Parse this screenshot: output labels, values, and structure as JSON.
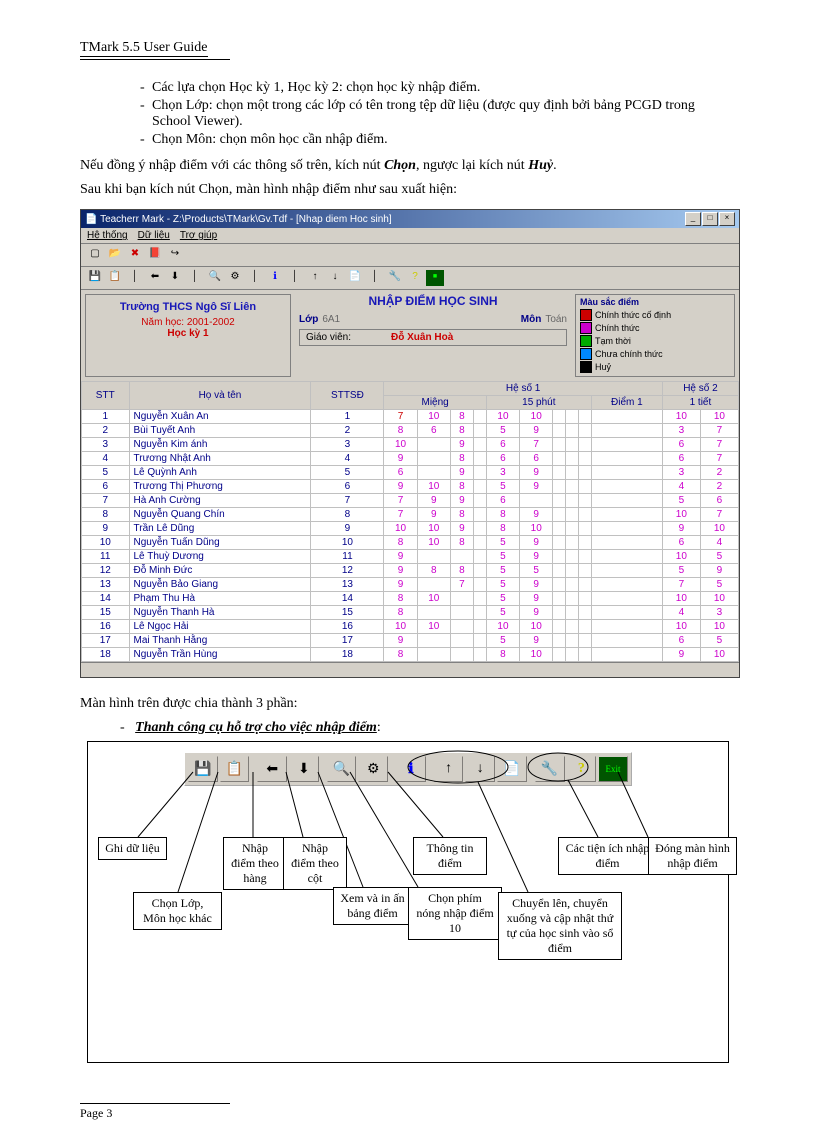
{
  "header": "TMark 5.5 User Guide",
  "bullets": [
    "Các lựa chọn Học kỳ 1, Học kỳ 2: chọn học kỳ nhập điểm.",
    "Chọn Lớp: chọn một trong các lớp có tên trong tệp dữ liệu (được quy định bởi bảng PCGD trong School Viewer).",
    "Chọn Môn: chọn môn học cần nhập điểm."
  ],
  "p1a": "Nếu đồng ý nhập điểm với các thông số trên, kích nút ",
  "p1b": "Chọn",
  "p1c": ", ngược lại kích nút ",
  "p1d": "Huỷ",
  "p1e": ".",
  "p2": "Sau khi bạn kích nút Chọn, màn hình nhập điểm như sau xuất hiện:",
  "win": {
    "title": "Teacherr Mark - Z:\\Products\\TMark\\Gv.Tdf - [Nhap diem Hoc sinh]",
    "menu": [
      "Hệ thống",
      "Dữ liệu",
      "Trợ giúp"
    ],
    "school": "Trường THCS Ngô Sĩ Liên",
    "year": "Năm học: 2001-2002",
    "sem": "Học kỳ 1",
    "mainTitle": "NHẬP ĐIỂM HỌC SINH",
    "lop": "Lớp",
    "lopv": "6A1",
    "mon": "Môn",
    "monv": "Toán",
    "gv": "Giáo viên:",
    "gvv": "Đỗ Xuân Hoà",
    "legend": {
      "h": "Màu sắc điểm",
      "items": [
        {
          "c": "#c00",
          "t": "Chính thức cố định"
        },
        {
          "c": "#c0c",
          "t": "Chính thức"
        },
        {
          "c": "#0a0",
          "t": "Tạm thời"
        },
        {
          "c": "#08f",
          "t": "Chưa chính thức"
        },
        {
          "c": "#000",
          "t": "Huỷ"
        }
      ]
    },
    "cols": {
      "stt": "STT",
      "name": "Họ và tên",
      "sttsd": "STTSĐ",
      "hs1": "Hệ số 1",
      "hs2": "Hệ số 2",
      "mieng": "Miệng",
      "p15": "15 phút",
      "d1": "Điểm 1",
      "t1": "1 tiết"
    },
    "rows": [
      {
        "i": 1,
        "n": "Nguyễn Xuân An",
        "s": 1,
        "m": [
          "7",
          "10",
          "8"
        ],
        "p": [
          "10",
          "10"
        ],
        "d": [],
        "t": [
          "10",
          "10"
        ]
      },
      {
        "i": 2,
        "n": "Bùi Tuyết Anh",
        "s": 2,
        "m": [
          "8",
          "6",
          "8"
        ],
        "p": [
          "5",
          "9"
        ],
        "d": [],
        "t": [
          "3",
          "7"
        ]
      },
      {
        "i": 3,
        "n": "Nguyễn Kim ánh",
        "s": 3,
        "m": [
          "10",
          "",
          "9"
        ],
        "p": [
          "6",
          "7"
        ],
        "d": [],
        "t": [
          "6",
          "7"
        ]
      },
      {
        "i": 4,
        "n": "Trương Nhật Anh",
        "s": 4,
        "m": [
          "9",
          "",
          "8"
        ],
        "p": [
          "6",
          "6"
        ],
        "d": [],
        "t": [
          "6",
          "7"
        ]
      },
      {
        "i": 5,
        "n": "Lê Quỳnh Anh",
        "s": 5,
        "m": [
          "6",
          "",
          "9"
        ],
        "p": [
          "3",
          "9"
        ],
        "d": [],
        "t": [
          "3",
          "2"
        ]
      },
      {
        "i": 6,
        "n": "Trương Thị Phương",
        "s": 6,
        "m": [
          "9",
          "10",
          "8"
        ],
        "p": [
          "5",
          "9"
        ],
        "d": [],
        "t": [
          "4",
          "2"
        ]
      },
      {
        "i": 7,
        "n": "Hà Anh Cường",
        "s": 7,
        "m": [
          "7",
          "9",
          "9"
        ],
        "p": [
          "6",
          ""
        ],
        "d": [],
        "t": [
          "5",
          "6"
        ]
      },
      {
        "i": 8,
        "n": "Nguyễn Quang Chín",
        "s": 8,
        "m": [
          "7",
          "9",
          "8"
        ],
        "p": [
          "8",
          "9"
        ],
        "d": [],
        "t": [
          "10",
          "7"
        ]
      },
      {
        "i": 9,
        "n": "Trần Lê Dũng",
        "s": 9,
        "m": [
          "10",
          "10",
          "9"
        ],
        "p": [
          "8",
          "10"
        ],
        "d": [],
        "t": [
          "9",
          "10"
        ]
      },
      {
        "i": 10,
        "n": "Nguyễn Tuấn Dũng",
        "s": 10,
        "m": [
          "8",
          "10",
          "8"
        ],
        "p": [
          "5",
          "9"
        ],
        "d": [],
        "t": [
          "6",
          "4"
        ]
      },
      {
        "i": 11,
        "n": "Lê Thuỳ Dương",
        "s": 11,
        "m": [
          "9",
          "",
          ""
        ],
        "p": [
          "5",
          "9"
        ],
        "d": [],
        "t": [
          "10",
          "5"
        ]
      },
      {
        "i": 12,
        "n": "Đỗ Minh Đức",
        "s": 12,
        "m": [
          "9",
          "8",
          "8"
        ],
        "p": [
          "5",
          "5"
        ],
        "d": [],
        "t": [
          "5",
          "9"
        ]
      },
      {
        "i": 13,
        "n": "Nguyễn Bảo Giang",
        "s": 13,
        "m": [
          "9",
          "",
          "7"
        ],
        "p": [
          "5",
          "9"
        ],
        "d": [],
        "t": [
          "7",
          "5"
        ]
      },
      {
        "i": 14,
        "n": "Phạm Thu Hà",
        "s": 14,
        "m": [
          "8",
          "10",
          ""
        ],
        "p": [
          "5",
          "9"
        ],
        "d": [],
        "t": [
          "10",
          "10"
        ]
      },
      {
        "i": 15,
        "n": "Nguyễn Thanh Hà",
        "s": 15,
        "m": [
          "8",
          "",
          ""
        ],
        "p": [
          "5",
          "9"
        ],
        "d": [],
        "t": [
          "4",
          "3"
        ]
      },
      {
        "i": 16,
        "n": "Lê Ngọc Hải",
        "s": 16,
        "m": [
          "10",
          "10",
          ""
        ],
        "p": [
          "10",
          "10"
        ],
        "d": [],
        "t": [
          "10",
          "10"
        ]
      },
      {
        "i": 17,
        "n": "Mai Thanh Hằng",
        "s": 17,
        "m": [
          "9",
          "",
          ""
        ],
        "p": [
          "5",
          "9"
        ],
        "d": [],
        "t": [
          "6",
          "5"
        ]
      },
      {
        "i": 18,
        "n": "Nguyễn Trần Hùng",
        "s": 18,
        "m": [
          "8",
          "",
          ""
        ],
        "p": [
          "8",
          "10"
        ],
        "d": [],
        "t": [
          "9",
          "10"
        ]
      }
    ]
  },
  "p3": "Màn hình trên được chia thành 3 phần:",
  "p4": "Thanh công cụ hỗ trợ cho việc nhập điểm",
  "callouts": {
    "c1": "Ghi dữ liệu",
    "c2": "Chọn Lớp, Môn học khác",
    "c3": "Nhập điểm theo hàng",
    "c4": "Nhập điểm theo cột",
    "c5": "Xem và in ấn bảng điểm",
    "c6": "Chọn phím nóng nhập điểm 10",
    "c7": "Thông tin điểm",
    "c8": "Chuyển lên, chuyển xuống và cập nhật thứ tự của học sinh vào sổ điểm",
    "c9": "Các tiện ích nhập điểm",
    "c10": "Đóng màn hình nhập điểm"
  },
  "page": "Page 3"
}
